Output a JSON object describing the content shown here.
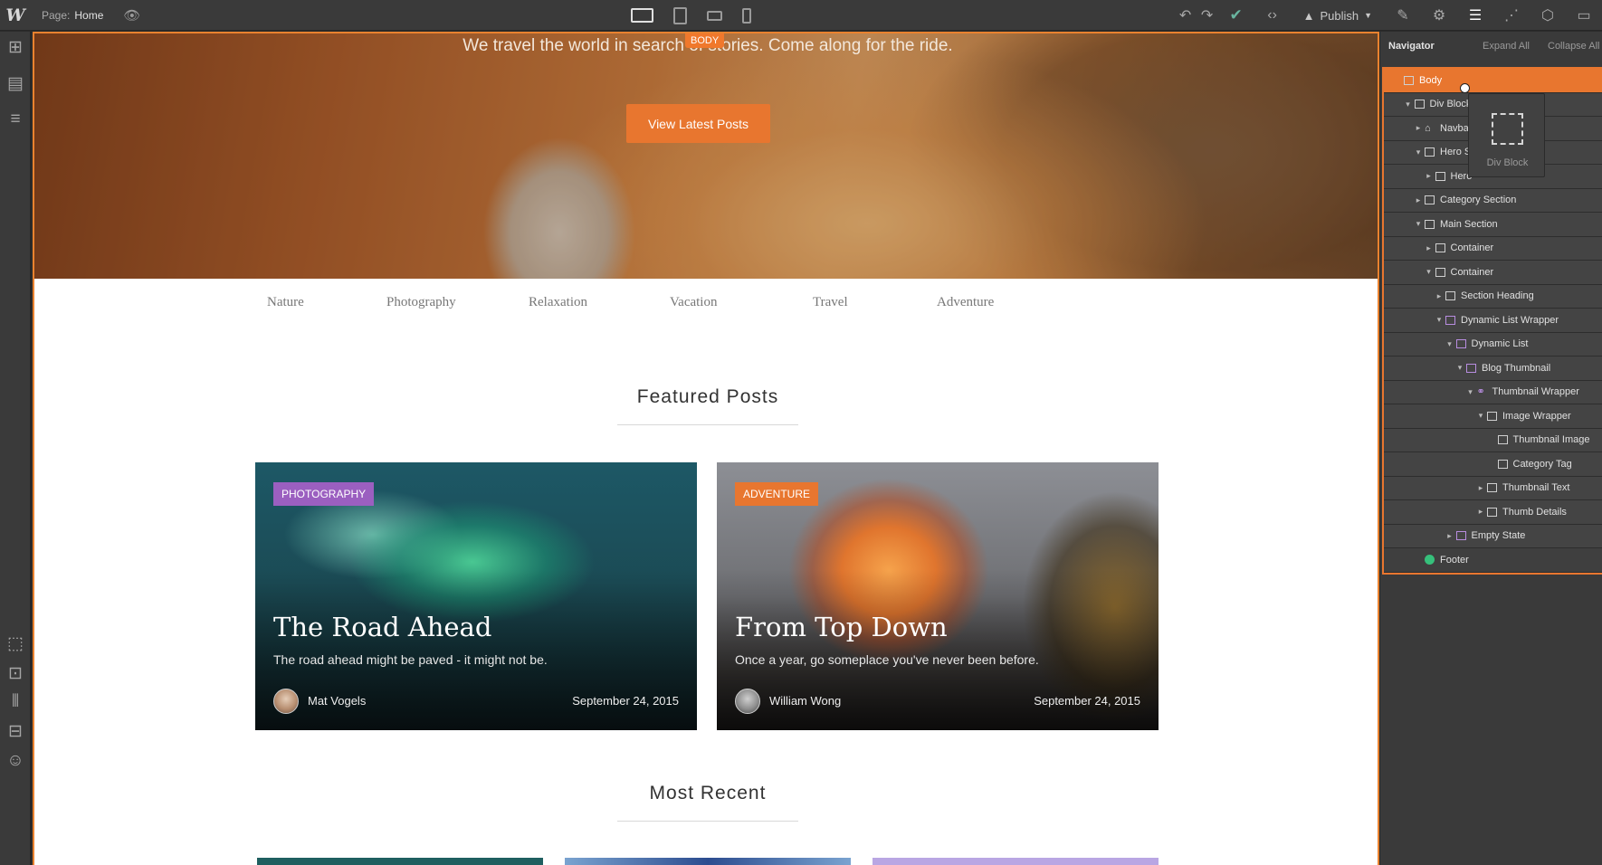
{
  "toolbar": {
    "logo": "W",
    "page_label": "Page:",
    "page_name": "Home",
    "publish_label": "Publish",
    "icons": [
      "eye-icon",
      "undo-icon",
      "redo-icon",
      "check-icon",
      "code-icon",
      "publish-icon",
      "brush-icon",
      "gear-icon",
      "navigator-icon",
      "layers-icon",
      "box-icon",
      "assets-icon"
    ]
  },
  "canvas": {
    "hero_tagline": "We travel the world in search of stories. Come along for the ride.",
    "body_badge": "BODY",
    "hero_button": "View Latest Posts",
    "categories": [
      "Nature",
      "Photography",
      "Relaxation",
      "Vacation",
      "Travel",
      "Adventure"
    ],
    "featured_title": "Featured Posts",
    "recent_title": "Most Recent",
    "posts": [
      {
        "tag": "PHOTOGRAPHY",
        "title": "The Road Ahead",
        "subtitle": "The road ahead might be paved - it might not be.",
        "author": "Mat Vogels",
        "date": "September 24, 2015"
      },
      {
        "tag": "ADVENTURE",
        "title": "From Top Down",
        "subtitle": "Once a year, go someplace you've never been before.",
        "author": "William Wong",
        "date": "September 24, 2015"
      }
    ]
  },
  "navigator": {
    "title": "Navigator",
    "expand_all": "Expand All",
    "collapse_all": "Collapse All",
    "tooltip_label": "Div Block",
    "tree": [
      {
        "label": "Body",
        "indent": 0,
        "caret": "",
        "icon": "box"
      },
      {
        "label": "Div Block",
        "indent": 1,
        "caret": "▾",
        "icon": "box"
      },
      {
        "label": "Navbar",
        "indent": 2,
        "caret": "▸",
        "icon": "navbar"
      },
      {
        "label": "Hero S",
        "indent": 2,
        "caret": "▾",
        "icon": "box"
      },
      {
        "label": "Hero",
        "indent": 3,
        "caret": "▸",
        "icon": "container"
      },
      {
        "label": "Category Section",
        "indent": 2,
        "caret": "▸",
        "icon": "box"
      },
      {
        "label": "Main Section",
        "indent": 2,
        "caret": "▾",
        "icon": "box"
      },
      {
        "label": "Container",
        "indent": 3,
        "caret": "▸",
        "icon": "container"
      },
      {
        "label": "Container",
        "indent": 3,
        "caret": "▾",
        "icon": "container"
      },
      {
        "label": "Section Heading",
        "indent": 4,
        "caret": "▸",
        "icon": "box"
      },
      {
        "label": "Dynamic List Wrapper",
        "indent": 4,
        "caret": "▾",
        "icon": "cms"
      },
      {
        "label": "Dynamic List",
        "indent": 5,
        "caret": "▾",
        "icon": "cms"
      },
      {
        "label": "Blog Thumbnail",
        "indent": 6,
        "caret": "▾",
        "icon": "cms"
      },
      {
        "label": "Thumbnail Wrapper",
        "indent": 7,
        "caret": "▾",
        "icon": "link"
      },
      {
        "label": "Image Wrapper",
        "indent": 8,
        "caret": "▾",
        "icon": "box"
      },
      {
        "label": "Thumbnail Image",
        "indent": 9,
        "caret": "",
        "icon": "image"
      },
      {
        "label": "Category Tag",
        "indent": 9,
        "caret": "",
        "icon": "text"
      },
      {
        "label": "Thumbnail Text",
        "indent": 8,
        "caret": "▸",
        "icon": "box"
      },
      {
        "label": "Thumb Details",
        "indent": 8,
        "caret": "▸",
        "icon": "box"
      },
      {
        "label": "Empty State",
        "indent": 5,
        "caret": "▸",
        "icon": "cms"
      },
      {
        "label": "Footer",
        "indent": 2,
        "caret": "",
        "icon": "symbol"
      }
    ]
  },
  "colors": {
    "accent": "#e8762f",
    "purple_tag": "#9b5fc0",
    "editor_bg": "#3a3a3a"
  }
}
